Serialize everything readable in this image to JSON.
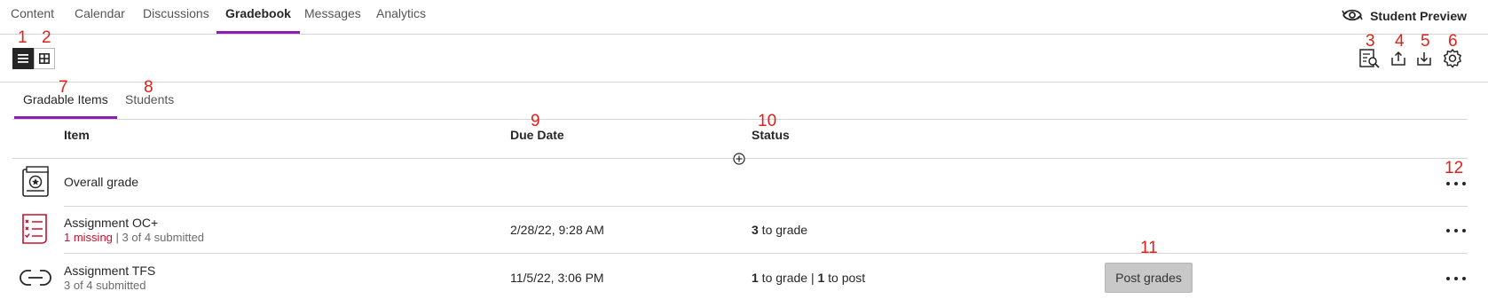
{
  "topnav": {
    "tabs": [
      {
        "label": "Content"
      },
      {
        "label": "Calendar"
      },
      {
        "label": "Discussions"
      },
      {
        "label": "Gradebook",
        "active": true
      },
      {
        "label": "Messages"
      },
      {
        "label": "Analytics"
      }
    ],
    "student_preview_label": "Student Preview",
    "student_preview_icon": "eye-refresh-icon"
  },
  "view_toggle": {
    "list_icon": "list-view-icon",
    "grid_icon": "grid-view-icon",
    "active": "list"
  },
  "tools": {
    "icons": [
      "grading-review-icon",
      "upload-icon",
      "download-icon",
      "settings-gear-icon"
    ]
  },
  "subtabs": {
    "items": [
      {
        "label": "Gradable Items",
        "active": true
      },
      {
        "label": "Students"
      }
    ]
  },
  "table": {
    "columns": {
      "item": "Item",
      "due_date": "Due Date",
      "status": "Status"
    },
    "rows": [
      {
        "icon": "overall-grade-icon",
        "name": "Overall grade",
        "missing": "",
        "submitted": "",
        "due_date": "",
        "status_count1": "",
        "status_text1": "",
        "status_sep": "",
        "status_count2": "",
        "status_text2": ""
      },
      {
        "icon": "assignment-red-icon",
        "name": "Assignment OC+",
        "missing": "1 missing",
        "separator": " | ",
        "submitted": "3 of 4 submitted",
        "due_date": "2/28/22, 9:28 AM",
        "status_count1": "3",
        "status_text1": " to grade"
      },
      {
        "icon": "link-icon",
        "name": "Assignment TFS",
        "submitted": "3 of 4 submitted",
        "due_date": "11/5/22, 3:06 PM",
        "status_count1": "1",
        "status_text1": " to grade | ",
        "status_count2": "1",
        "status_text2": " to post",
        "post_button": "Post grades"
      }
    ]
  },
  "markers": [
    "1",
    "2",
    "3",
    "4",
    "5",
    "6",
    "7",
    "8",
    "9",
    "10",
    "11",
    "12"
  ],
  "colors": {
    "accent": "#8c1eb4",
    "missing": "#c8102e",
    "marker": "#e0201b"
  }
}
